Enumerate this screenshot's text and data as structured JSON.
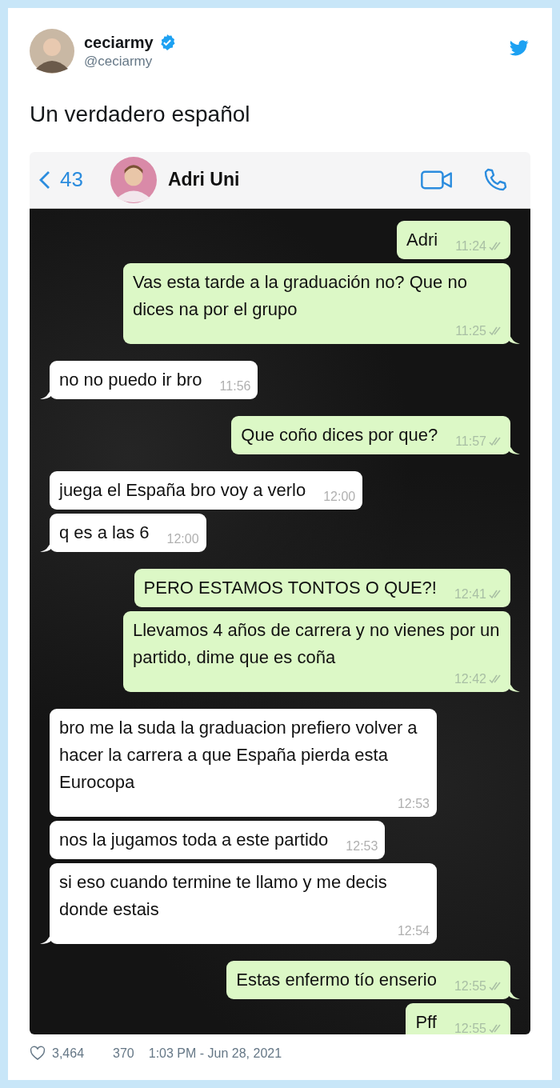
{
  "tweet": {
    "display_name": "ceciarmy",
    "verified": true,
    "handle": "@ceciarmy",
    "text": "Un verdadero español"
  },
  "chat": {
    "back_count": "43",
    "contact": "Adri Uni",
    "messages": [
      {
        "kind": "outgoing",
        "text": "Adri",
        "time": "11:24",
        "tail": false
      },
      {
        "kind": "outgoing",
        "text": "Vas esta tarde a la graduación no? Que no dices na por el grupo",
        "time": "11:25",
        "tail": true
      },
      {
        "kind": "incoming",
        "text": "no no puedo ir bro",
        "time": "11:56",
        "tail": true
      },
      {
        "kind": "outgoing",
        "text": "Que coño dices por que?",
        "time": "11:57",
        "tail": true
      },
      {
        "kind": "incoming",
        "text": "juega el España bro voy a verlo",
        "time": "12:00",
        "tail": false
      },
      {
        "kind": "incoming",
        "text": "q es a las 6",
        "time": "12:00",
        "tail": true
      },
      {
        "kind": "outgoing",
        "text": "PERO ESTAMOS TONTOS O QUE?!",
        "time": "12:41",
        "tail": false
      },
      {
        "kind": "outgoing",
        "text": "Llevamos 4 años de carrera y no vienes por un partido, dime que es coña",
        "time": "12:42",
        "tail": true
      },
      {
        "kind": "incoming",
        "text": "bro me la suda la graduacion prefiero volver a hacer la carrera a que España pierda esta Eurocopa",
        "time": "12:53",
        "tail": false
      },
      {
        "kind": "incoming",
        "text": "nos la jugamos toda a este partido",
        "time": "12:53",
        "tail": false
      },
      {
        "kind": "incoming",
        "text": "si eso cuando termine te llamo y me decis donde estais",
        "time": "12:54",
        "tail": true
      },
      {
        "kind": "outgoing",
        "text": "Estas enfermo tío enserio",
        "time": "12:55",
        "tail": true
      },
      {
        "kind": "outgoing",
        "text": "Pff",
        "time": "12:55"
      }
    ]
  },
  "footer": {
    "likes": "3,464",
    "replies": "370",
    "timestamp": "1:03 PM - Jun 28, 2021"
  }
}
